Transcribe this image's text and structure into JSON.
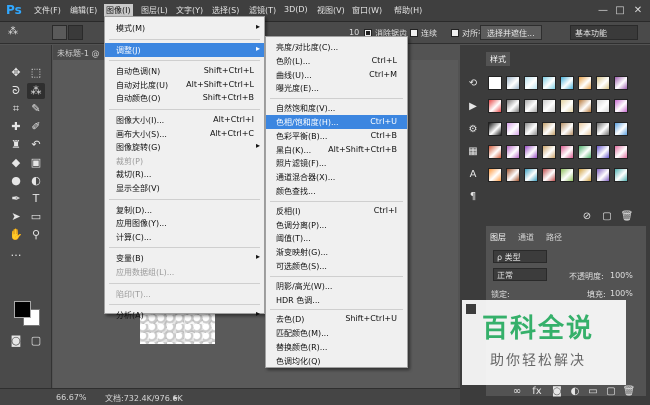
{
  "app": {
    "logo": "Ps"
  },
  "menubar": {
    "items": [
      "文件(F)",
      "编辑(E)",
      "图像(I)",
      "图层(L)",
      "文字(Y)",
      "选择(S)",
      "滤镜(T)",
      "3D(D)",
      "视图(V)",
      "窗口(W)",
      "帮助(H)"
    ],
    "active_index": 2,
    "window_controls": [
      "—",
      "□",
      "✕"
    ]
  },
  "options_bar": {
    "tolerance_fragment": "10",
    "checkboxes": [
      {
        "label": "消除锯齿",
        "checked": true
      },
      {
        "label": "连续",
        "checked": false
      },
      {
        "label": "对所有图层取样",
        "checked": false
      }
    ],
    "subject_button": "选择并遮住...",
    "workspace": "基本功能"
  },
  "document": {
    "tab_title": "未标题-1 @"
  },
  "status": {
    "zoom": "66.67%",
    "doc_info": "文档:732.4K/976.6K"
  },
  "image_menu": {
    "items": [
      {
        "label": "模式(M)",
        "shortcut": "",
        "submenu": true,
        "disabled": false
      },
      {
        "sep": true
      },
      {
        "label": "调整(J)",
        "shortcut": "",
        "submenu": true,
        "disabled": false,
        "highlight": true
      },
      {
        "sep": true
      },
      {
        "label": "自动色调(N)",
        "shortcut": "Shift+Ctrl+L"
      },
      {
        "label": "自动对比度(U)",
        "shortcut": "Alt+Shift+Ctrl+L"
      },
      {
        "label": "自动颜色(O)",
        "shortcut": "Shift+Ctrl+B"
      },
      {
        "sep": true
      },
      {
        "label": "图像大小(I)...",
        "shortcut": "Alt+Ctrl+I"
      },
      {
        "label": "画布大小(S)...",
        "shortcut": "Alt+Ctrl+C"
      },
      {
        "label": "图像旋转(G)",
        "submenu": true
      },
      {
        "label": "裁剪(P)",
        "disabled": true
      },
      {
        "label": "裁切(R)..."
      },
      {
        "label": "显示全部(V)"
      },
      {
        "sep": true
      },
      {
        "label": "复制(D)..."
      },
      {
        "label": "应用图像(Y)..."
      },
      {
        "label": "计算(C)..."
      },
      {
        "sep": true
      },
      {
        "label": "变量(B)",
        "submenu": true
      },
      {
        "label": "应用数据组(L)...",
        "disabled": true
      },
      {
        "sep": true
      },
      {
        "label": "陷印(T)...",
        "disabled": true
      },
      {
        "sep": true
      },
      {
        "label": "分析(A)",
        "submenu": true
      }
    ]
  },
  "adjust_menu": {
    "items": [
      {
        "label": "亮度/对比度(C)...",
        "shortcut": ""
      },
      {
        "label": "色阶(L)...",
        "shortcut": "Ctrl+L"
      },
      {
        "label": "曲线(U)...",
        "shortcut": "Ctrl+M"
      },
      {
        "label": "曝光度(E)...",
        "shortcut": ""
      },
      {
        "sep": true
      },
      {
        "label": "自然饱和度(V)...",
        "shortcut": ""
      },
      {
        "label": "色相/饱和度(H)...",
        "shortcut": "Ctrl+U",
        "highlight": true
      },
      {
        "label": "色彩平衡(B)...",
        "shortcut": "Ctrl+B"
      },
      {
        "label": "黑白(K)...",
        "shortcut": "Alt+Shift+Ctrl+B"
      },
      {
        "label": "照片滤镜(F)...",
        "shortcut": ""
      },
      {
        "label": "通道混合器(X)...",
        "shortcut": ""
      },
      {
        "label": "颜色查找...",
        "shortcut": ""
      },
      {
        "sep": true
      },
      {
        "label": "反相(I)",
        "shortcut": "Ctrl+I"
      },
      {
        "label": "色调分离(P)...",
        "shortcut": ""
      },
      {
        "label": "阈值(T)...",
        "shortcut": ""
      },
      {
        "label": "渐变映射(G)...",
        "shortcut": ""
      },
      {
        "label": "可选颜色(S)...",
        "shortcut": ""
      },
      {
        "sep": true
      },
      {
        "label": "阴影/高光(W)...",
        "shortcut": ""
      },
      {
        "label": "HDR 色调...",
        "shortcut": ""
      },
      {
        "sep": true
      },
      {
        "label": "去色(D)",
        "shortcut": "Shift+Ctrl+U"
      },
      {
        "label": "匹配颜色(M)...",
        "shortcut": ""
      },
      {
        "label": "替换颜色(R)...",
        "shortcut": ""
      },
      {
        "label": "色调均化(Q)",
        "shortcut": ""
      }
    ]
  },
  "styles_panel": {
    "tab": "样式"
  },
  "layers_panel": {
    "tabs": [
      "图层",
      "通道",
      "路径"
    ],
    "filter": "ρ 类型",
    "blend_mode": "正常",
    "opacity_label": "不透明度:",
    "opacity_value": "100%",
    "lock_label": "锁定:",
    "fill_label": "填充:",
    "fill_value": "100%"
  },
  "watermark": {
    "title": "百科全说",
    "subtitle": "助你轻松解决"
  }
}
